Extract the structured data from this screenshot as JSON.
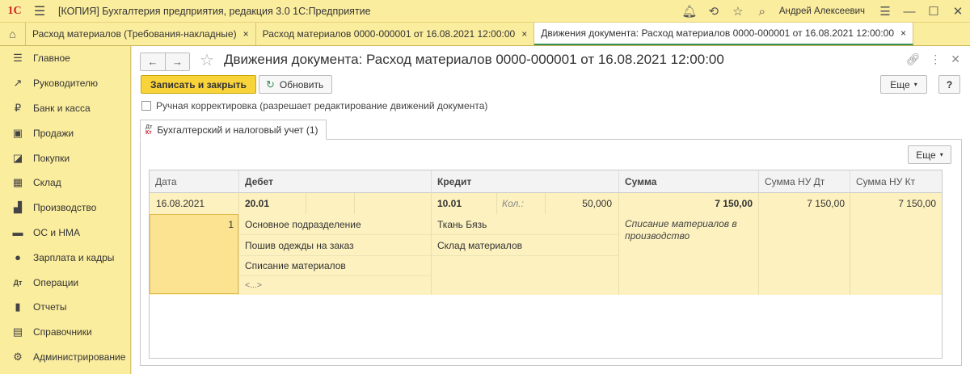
{
  "app": {
    "logo": "1С",
    "title": "[КОПИЯ] Бухгалтерия предприятия, редакция 3.0 1С:Предприятие",
    "user": "Андрей Алексеевич"
  },
  "tabs": [
    {
      "label": "Расход материалов (Требования-накладные)",
      "close": "×"
    },
    {
      "label": "Расход материалов 0000-000001 от 16.08.2021 12:00:00",
      "close": "×"
    },
    {
      "label": "Движения документа: Расход материалов 0000-000001 от 16.08.2021 12:00:00",
      "close": "×",
      "active": true
    }
  ],
  "sidebar": {
    "items": [
      {
        "label": "Главное",
        "icon": "☰"
      },
      {
        "label": "Руководителю",
        "icon": "↗"
      },
      {
        "label": "Банк и касса",
        "icon": "₽"
      },
      {
        "label": "Продажи",
        "icon": "▣"
      },
      {
        "label": "Покупки",
        "icon": "◪"
      },
      {
        "label": "Склад",
        "icon": "▦"
      },
      {
        "label": "Производство",
        "icon": "▟"
      },
      {
        "label": "ОС и НМА",
        "icon": "▬"
      },
      {
        "label": "Зарплата и кадры",
        "icon": "●"
      },
      {
        "label": "Операции",
        "icon": "Дт"
      },
      {
        "label": "Отчеты",
        "icon": "▮"
      },
      {
        "label": "Справочники",
        "icon": "▤"
      },
      {
        "label": "Администрирование",
        "icon": "⚙"
      }
    ]
  },
  "doc": {
    "title": "Движения документа: Расход материалов 0000-000001 от 16.08.2021 12:00:00",
    "save_close": "Записать и закрыть",
    "refresh": "Обновить",
    "more": "Еще",
    "help": "?",
    "manual_label": "Ручная корректировка (разрешает редактирование движений документа)",
    "inner_tab": "Бухгалтерский и налоговый учет (1)",
    "inner_tab_icon": "Дт/Кт",
    "more2": "Еще"
  },
  "grid": {
    "headers": [
      "Дата",
      "Дебет",
      "Кредит",
      "Сумма",
      "Сумма НУ Дт",
      "Сумма НУ Кт"
    ],
    "row": {
      "date": "16.08.2021",
      "num": "1",
      "debit_account": "20.01",
      "debit_sub1": "Основное подразделение",
      "debit_sub2": "Пошив одежды на заказ",
      "debit_sub3": "Списание материалов",
      "debit_sub4": "<...>",
      "credit_account": "10.01",
      "qty_label": "Кол.:",
      "qty": "50,000",
      "credit_sub1": "Ткань Бязь",
      "credit_sub2": "Склад материалов",
      "sum": "7 150,00",
      "content": "Списание материалов в производство",
      "nu_dt": "7 150,00",
      "nu_kt": "7 150,00"
    }
  }
}
